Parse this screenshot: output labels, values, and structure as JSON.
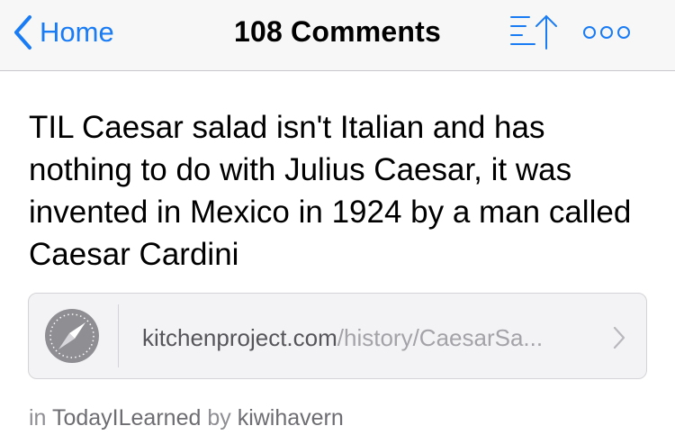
{
  "nav": {
    "back_label": "Home",
    "title": "108 Comments",
    "accent_color": "#1a7cf5",
    "icons": [
      "chevron-left-icon",
      "sort-icon",
      "more-icon"
    ]
  },
  "post": {
    "title": "TIL Caesar salad isn't Italian and has nothing to do with Julius Caesar, it was invented in Mexico in 1924 by a man called Caesar Cardini",
    "link": {
      "domain": "kitchenproject.com",
      "path": "/history/CaesarSa...",
      "icon": "compass-icon"
    },
    "meta": {
      "in_label": "in",
      "subreddit": "TodayILearned",
      "by_label": "by",
      "author": "kiwihavern"
    }
  }
}
